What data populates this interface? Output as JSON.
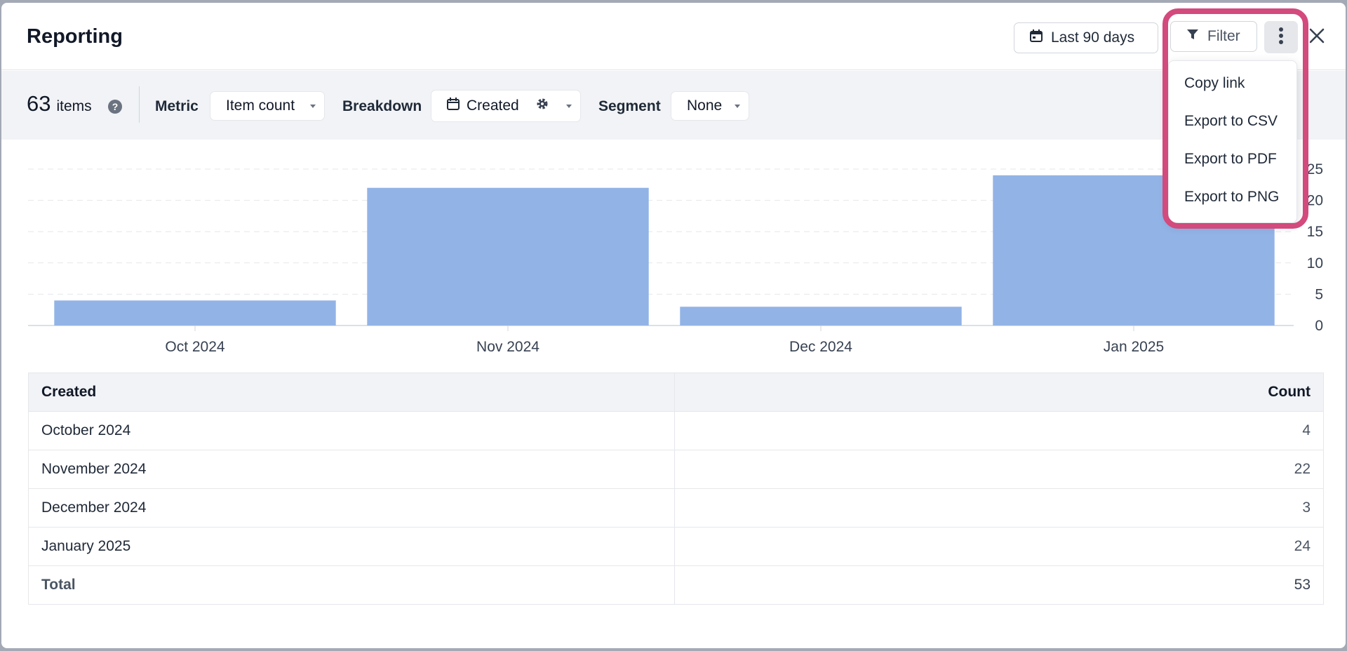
{
  "header": {
    "title": "Reporting",
    "date_range": "Last 90 days",
    "filter": "Filter"
  },
  "toolbar": {
    "count": "63",
    "count_unit": "items",
    "metric_label": "Metric",
    "metric_value": "Item count",
    "breakdown_label": "Breakdown",
    "breakdown_value": "Created",
    "segment_label": "Segment",
    "segment_value": "None"
  },
  "menu": {
    "items": [
      "Copy link",
      "Export to CSV",
      "Export to PDF",
      "Export to PNG"
    ]
  },
  "chart_data": {
    "type": "bar",
    "categories": [
      "Oct 2024",
      "Nov 2024",
      "Dec 2024",
      "Jan 2025"
    ],
    "values": [
      4,
      22,
      3,
      24
    ],
    "y_ticks": [
      "0",
      "5",
      "10",
      "15",
      "20",
      "25"
    ],
    "ylim": [
      0,
      25
    ],
    "grid": true,
    "bar_color": "#92b3e6"
  },
  "table": {
    "headers": [
      "Created",
      "Count"
    ],
    "rows": [
      [
        "October 2024",
        "4"
      ],
      [
        "November 2024",
        "22"
      ],
      [
        "December 2024",
        "3"
      ],
      [
        "January 2025",
        "24"
      ]
    ],
    "total_label": "Total",
    "total_value": "53"
  },
  "colors": {
    "accent_highlight": "#d34a7d",
    "bar": "#92b3e6"
  }
}
